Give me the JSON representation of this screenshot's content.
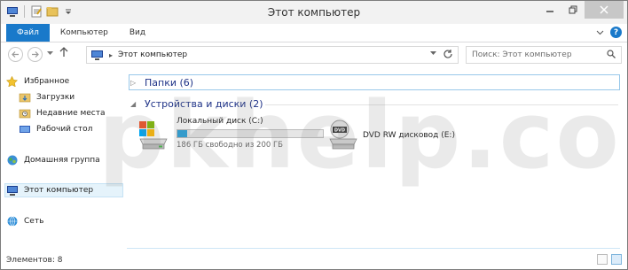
{
  "window": {
    "title": "Этот компьютер"
  },
  "ribbon": {
    "tabs": [
      {
        "label": "Файл"
      },
      {
        "label": "Компьютер"
      },
      {
        "label": "Вид"
      }
    ],
    "help_glyph": "?"
  },
  "address": {
    "path": "Этот компьютер",
    "search_placeholder": "Поиск: Этот компьютер"
  },
  "navigation": {
    "favorites": "Избранное",
    "favorites_items": [
      "Загрузки",
      "Недавние места",
      "Рабочий стол"
    ],
    "homegroup": "Домашняя группа",
    "this_pc": "Этот компьютер",
    "network": "Сеть"
  },
  "content": {
    "folders_group": "Папки (6)",
    "devices_group": "Устройства и диски (2)",
    "drives": [
      {
        "name": "Локальный диск (C:)",
        "free": "186 ГБ свободно из 200 ГБ",
        "used_fraction": 0.07
      },
      {
        "name": "DVD RW дисковод (E:)"
      }
    ]
  },
  "status": {
    "items": "Элементов: 8"
  },
  "watermark": "pkhelp.com",
  "colors": {
    "accent": "#1979ca",
    "selection": "#e5f3fb",
    "group_text": "#1e3287",
    "progress": "#26a0da"
  }
}
